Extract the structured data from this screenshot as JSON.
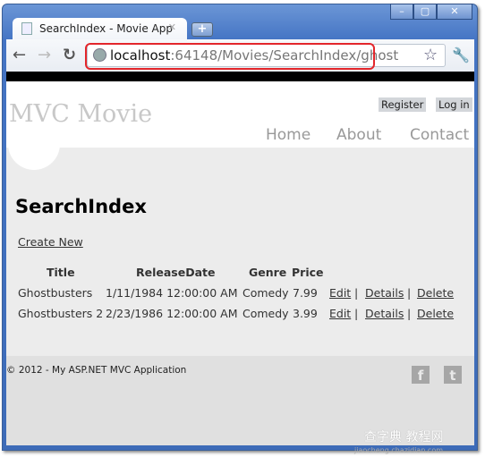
{
  "browser": {
    "tab_title": "SearchIndex - Movie App",
    "url_host": "localhost",
    "url_rest": ":64148/Movies/SearchIndex/ghost"
  },
  "header": {
    "site_title": "MVC Movie",
    "register": "Register",
    "login": "Log in",
    "nav": [
      "Home",
      "About",
      "Contact"
    ]
  },
  "main": {
    "heading": "SearchIndex",
    "create_new": "Create New",
    "columns": [
      "Title",
      "ReleaseDate",
      "Genre",
      "Price"
    ],
    "rows": [
      {
        "title": "Ghostbusters",
        "date": "1/11/1984 12:00:00 AM",
        "genre": "Comedy",
        "price": "7.99"
      },
      {
        "title": "Ghostbusters 2",
        "date": "2/23/1986 12:00:00 AM",
        "genre": "Comedy",
        "price": "3.99"
      }
    ],
    "actions": {
      "edit": "Edit",
      "details": "Details",
      "delete": "Delete",
      "sep": "|"
    }
  },
  "footer": {
    "copyright": "© 2012 - My ASP.NET MVC Application",
    "icons": [
      "facebook-icon",
      "twitter-icon"
    ]
  },
  "watermark": {
    "text": "查字典 教程网",
    "sub": "jiaocheng.chazidian.com"
  }
}
